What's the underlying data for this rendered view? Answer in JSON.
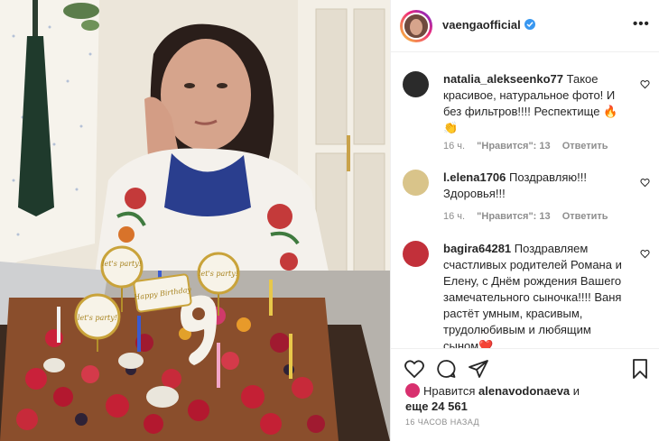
{
  "post": {
    "username": "vaengaofficial",
    "more_icon": "more-dots-icon",
    "verified_icon": "verified-badge-icon"
  },
  "comments": [
    {
      "username": "natalia_alekseenko77",
      "text": "Такое красивое, натуральное фото! И без фильтров!!!! Респектище 🔥👏",
      "time": "16 ч.",
      "likes": "\"Нравится\": 13",
      "reply": "Ответить",
      "avatar_color": "#2b2b2b"
    },
    {
      "username": "l.elena1706",
      "text": "Поздравляю!!! Здоровья!!!",
      "time": "16 ч.",
      "likes": "\"Нравится\": 13",
      "reply": "Ответить",
      "avatar_color": "#d9c48a"
    },
    {
      "username": "bagira64281",
      "text": "Поздравляем счастливых родителей Романа и Елену, с Днём рождения Вашего замечательного сыночка!!!! Ваня растёт умным, красивым, трудолюбивым и любящим сыном❤️",
      "avatar_color": "#c2303a"
    }
  ],
  "actions": {
    "like_icon": "heart-icon",
    "comment_icon": "comment-icon",
    "share_icon": "share-icon",
    "save_icon": "bookmark-icon"
  },
  "likes": {
    "prefix": "Нравится",
    "user": "alenavodonaeva",
    "and": "и",
    "more": "еще 24 561"
  },
  "timestamp": "16 ЧАСОВ НАЗАД",
  "photo": {
    "cake_signs": [
      "let's party!",
      "let's party!",
      "let's party!",
      "Happy Birthday"
    ],
    "candle_number": "9"
  },
  "colors": {
    "accent": "#3897f0",
    "muted": "#8e8e8e",
    "border": "#efefef",
    "text": "#262626"
  }
}
